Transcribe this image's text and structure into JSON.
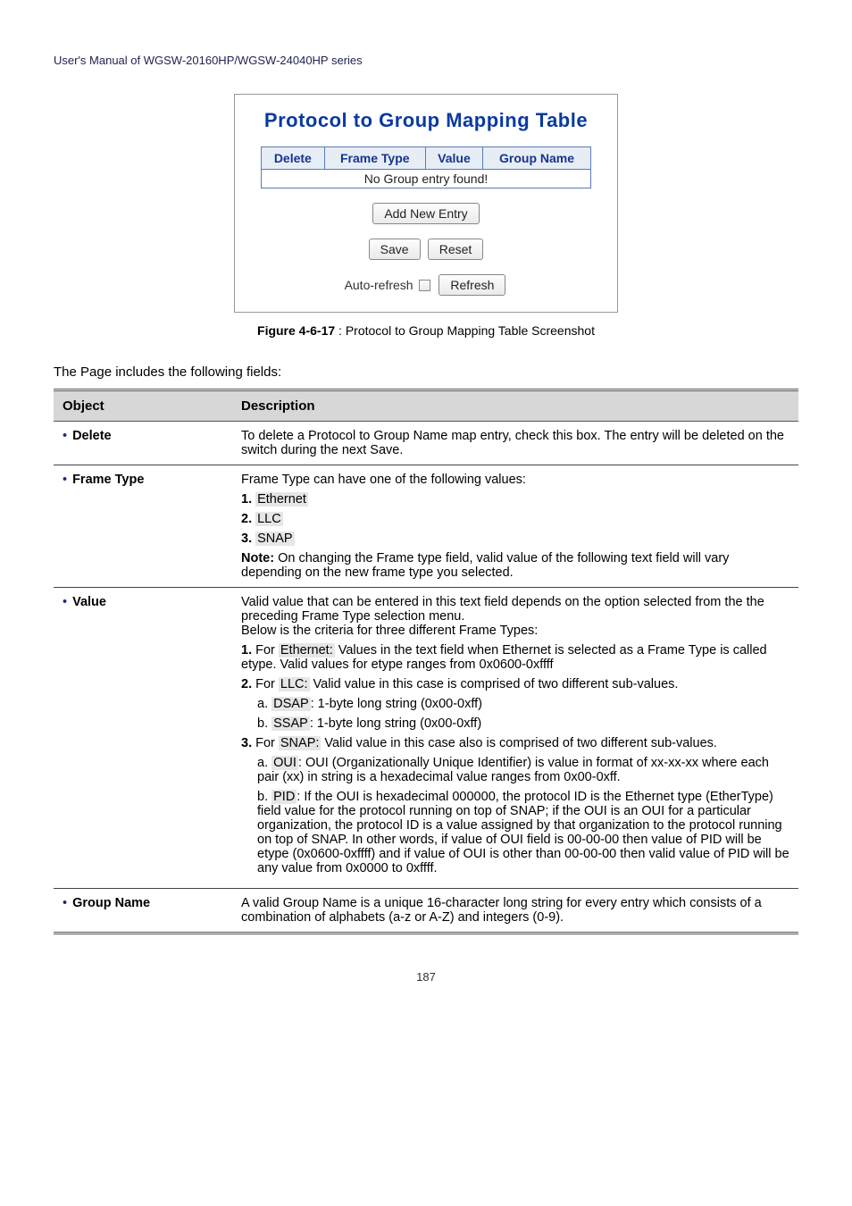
{
  "header": {
    "title": "User's Manual of WGSW-20160HP/WGSW-24040HP series",
    "page": "187"
  },
  "figure": {
    "title": "Protocol to Group Mapping Table",
    "columns": [
      "Delete",
      "Frame Type",
      "Value",
      "Group Name"
    ],
    "empty_msg": "No Group entry found!",
    "buttons": {
      "add": "Add New Entry",
      "save": "Save",
      "reset": "Reset",
      "refresh": "Refresh"
    },
    "auto_label": "Auto-refresh",
    "caption_bold": "Figure 4-6-17",
    "caption_rest": " : Protocol to Group Mapping Table Screenshot"
  },
  "intro": "The Page includes the following fields:",
  "table": {
    "headers": [
      "Object",
      "Description"
    ],
    "rows": [
      {
        "label": "Delete",
        "desc_html": "To delete a Protocol to Group Name map entry, check this box. The entry will be deleted on the switch during the next Save."
      },
      {
        "label": "Frame Type",
        "desc_parts": [
          {
            "t": "Frame Type can have one of the following values:"
          },
          {
            "ol": [
              {
                "hl": "Ethernet",
                "rest": ""
              },
              {
                "hl": "LLC",
                "rest": ""
              },
              {
                "hl": "SNAP",
                "rest": ""
              }
            ]
          },
          {
            "note_b": "Note:",
            "note_rest": " On changing the Frame type field, valid value of the following text field will vary depending on the new frame type you selected."
          }
        ]
      },
      {
        "label": "Value",
        "desc_parts": [
          {
            "t": "Valid value that can be entered in this text field depends on the option selected from the the preceding Frame Type selection menu."
          },
          {
            "t": "Below is the criteria for three different Frame Types:"
          },
          {
            "ol2": [
              {
                "pre": "For ",
                "hl": "Ethernet:",
                "rest": " Values in the text field when Ethernet is selected as a Frame Type is called etype. Valid values for etype ranges from 0x0600-0xffff"
              },
              {
                "pre": "For ",
                "hl": "LLC:",
                "rest": " Valid value in this case is comprised of two different sub-values.",
                "sub": [
                  {
                    "k": "a.",
                    "hl": "DSAP",
                    "rest": ": 1-byte long string (0x00-0xff)"
                  },
                  {
                    "k": "b.",
                    "hl": "SSAP",
                    "rest": ": 1-byte long string (0x00-0xff)"
                  }
                ]
              },
              {
                "pre": "For ",
                "hl": "SNAP:",
                "rest": " Valid value in this case also is comprised of two different sub-values.",
                "sub": [
                  {
                    "k": "a.",
                    "hl": "OUI",
                    "rest": ": OUI (Organizationally Unique Identifier) is value in format of xx-xx-xx where each pair (xx) in string is a hexadecimal value ranges from 0x00-0xff."
                  },
                  {
                    "k": "b.",
                    "hl": "PID",
                    "rest": ": If the OUI is hexadecimal 000000, the protocol ID is the Ethernet type (EtherType) field value for the protocol running on top of SNAP; if the OUI is an OUI for a particular organization, the protocol ID is a value assigned by that organization to the protocol running on top of SNAP. In other words, if value of OUI field is 00-00-00 then value of PID will be etype (0x0600-0xffff) and if value of OUI is other than 00-00-00 then valid value of PID will be any value from 0x0000 to 0xffff."
                  }
                ]
              }
            ]
          }
        ]
      },
      {
        "label": "Group Name",
        "desc_html": "A valid Group Name is a unique 16-character long string for every entry which consists of a combination of alphabets (a-z or A-Z) and integers (0-9)."
      }
    ]
  }
}
